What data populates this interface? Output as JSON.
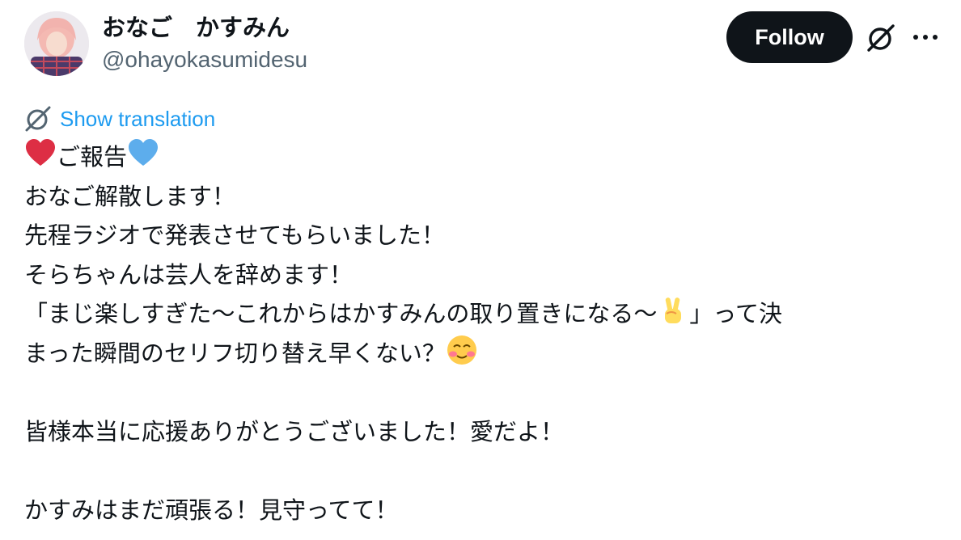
{
  "header": {
    "display_name": "おなご　かすみん",
    "handle": "@ohayokasumidesu",
    "follow_label": "Follow",
    "grok_icon": "grok-slash-icon",
    "more_icon": "more-dots-icon"
  },
  "translation": {
    "icon": "globe-translate-icon",
    "label": "Show translation"
  },
  "tweet": {
    "line1": "ご報告",
    "line2": "おなご解散します！",
    "line3": "先程ラジオで発表させてもらいました！",
    "line4": "そらちゃんは芸人を辞めます！",
    "line5": "「まじ楽しすぎた～これからはかすみんの取り置きになる～",
    "line5_end": "」って決",
    "line6": "まった瞬間のセリフ切り替え早くない？",
    "line8": "皆様本当に応援ありがとうございました！愛だよ！",
    "line10": "かすみはまだ頑張る！見守ってて！",
    "emojis": [
      "red-heart",
      "blue-heart",
      "victory-hand",
      "smiling-face"
    ]
  },
  "colors": {
    "follow_bg": "#0f1419",
    "link": "#1d9bf0",
    "text": "#0f1419",
    "secondary": "#536471"
  }
}
